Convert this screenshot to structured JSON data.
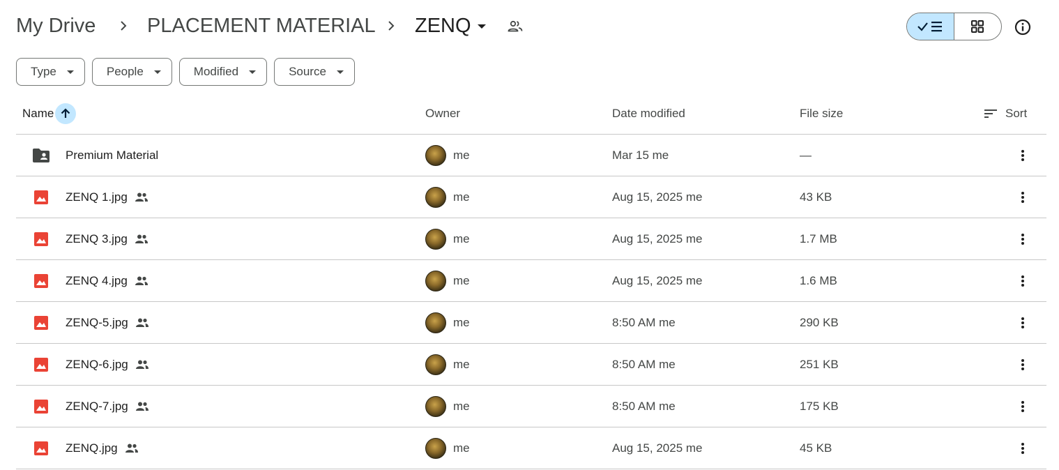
{
  "breadcrumb": {
    "root": "My Drive",
    "parent": "PLACEMENT MATERIAL",
    "current": "ZENQ"
  },
  "icons": {
    "separator": "chevron-right-icon",
    "current_dropdown": "caret-down-icon",
    "shared_folder": "people-icon",
    "list_view": "check-list-icon",
    "grid_view": "grid-icon",
    "info": "info-icon",
    "sort": "sort-lines-icon",
    "sort_direction": "arrow-up-icon",
    "more": "more-vert-icon"
  },
  "view_toggle": {
    "selected": "list"
  },
  "filters": [
    "Type",
    "People",
    "Modified",
    "Source"
  ],
  "columns": {
    "name": "Name",
    "owner": "Owner",
    "date_modified": "Date modified",
    "file_size": "File size",
    "sort": "Sort"
  },
  "colors": {
    "accent_light": "#c2e7ff",
    "image_icon": "#ea4335",
    "folder_icon": "#444746",
    "border": "#c7c7c7"
  },
  "files": [
    {
      "type": "shared-folder",
      "name": "Premium Material",
      "shared": false,
      "owner": "me",
      "modified": "Mar 15 me",
      "size": "—"
    },
    {
      "type": "image",
      "name": "ZENQ 1.jpg",
      "shared": true,
      "owner": "me",
      "modified": "Aug 15, 2025 me",
      "size": "43 KB"
    },
    {
      "type": "image",
      "name": "ZENQ 3.jpg",
      "shared": true,
      "owner": "me",
      "modified": "Aug 15, 2025 me",
      "size": "1.7 MB"
    },
    {
      "type": "image",
      "name": "ZENQ 4.jpg",
      "shared": true,
      "owner": "me",
      "modified": "Aug 15, 2025 me",
      "size": "1.6 MB"
    },
    {
      "type": "image",
      "name": "ZENQ-5.jpg",
      "shared": true,
      "owner": "me",
      "modified": "8:50 AM me",
      "size": "290 KB"
    },
    {
      "type": "image",
      "name": "ZENQ-6.jpg",
      "shared": true,
      "owner": "me",
      "modified": "8:50 AM me",
      "size": "251 KB"
    },
    {
      "type": "image",
      "name": "ZENQ-7.jpg",
      "shared": true,
      "owner": "me",
      "modified": "8:50 AM me",
      "size": "175 KB"
    },
    {
      "type": "image",
      "name": "ZENQ.jpg",
      "shared": true,
      "owner": "me",
      "modified": "Aug 15, 2025 me",
      "size": "45 KB"
    }
  ]
}
